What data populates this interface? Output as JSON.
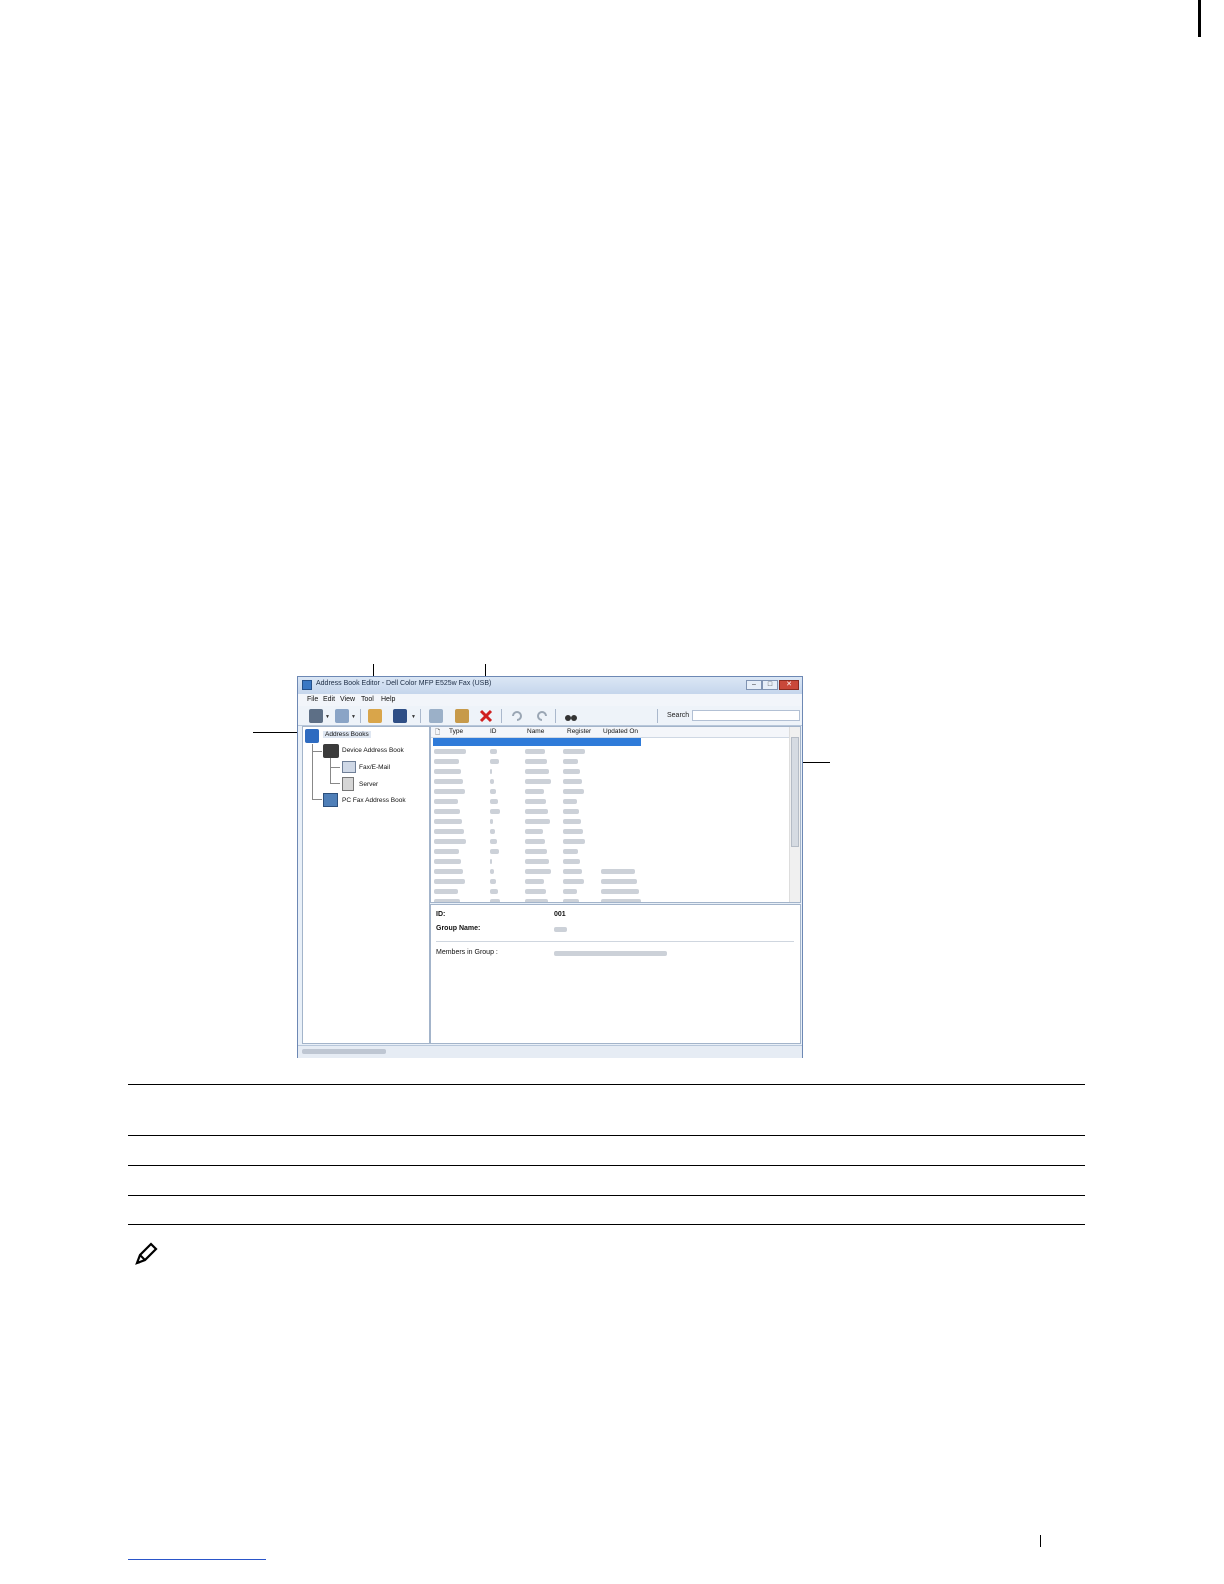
{
  "window": {
    "title": "Address Book Editor - Dell Color MFP E525w Fax (USB)",
    "min_label": "–",
    "max_label": "□",
    "close_label": "✕"
  },
  "menu": {
    "file": "File",
    "edit": "Edit",
    "view": "View",
    "tool": "Tool",
    "help": "Help"
  },
  "toolbar": {
    "search_label": "Search",
    "search_value": ""
  },
  "tree": {
    "root": "Address Books",
    "device_book": "Device Address Book",
    "fax_email": "Fax/E-Mail",
    "server": "Server",
    "pc_fax_book": "PC Fax Address Book"
  },
  "list": {
    "columns": [
      "Type",
      "ID",
      "Name",
      "Register",
      "Updated On"
    ]
  },
  "detail": {
    "id_label": "ID:",
    "id_value": "001",
    "group_name_label": "Group Name:",
    "members_label": "Members in Group :"
  },
  "icons": {
    "new-entry": "person-plus-icon",
    "save": "floppy-icon",
    "delete": "red-x-icon",
    "undo": "undo-icon",
    "redo": "redo-icon",
    "find": "binoculars-icon",
    "note": "pencil-note-icon"
  }
}
